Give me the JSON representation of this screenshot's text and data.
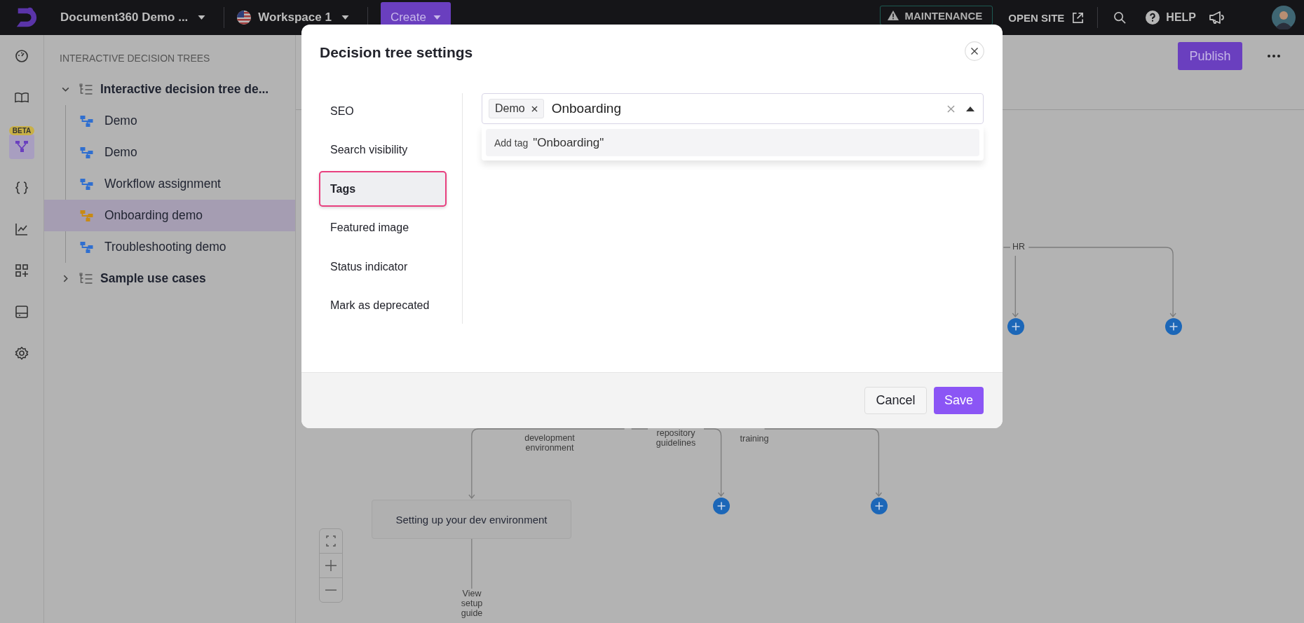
{
  "top_bar": {
    "project": "Document360 Demo ...",
    "workspace": "Workspace 1",
    "create": "Create",
    "maintenance": "MAINTENANCE",
    "open_site": "OPEN SITE",
    "help": "HELP"
  },
  "rail": [
    {
      "kind": "dashboard",
      "selected": false
    },
    {
      "kind": "book",
      "selected": false
    },
    {
      "kind": "tree",
      "selected": true,
      "badge": "BETA"
    },
    {
      "kind": "braces",
      "selected": false
    },
    {
      "kind": "chart",
      "selected": false
    },
    {
      "kind": "apps",
      "selected": false
    },
    {
      "kind": "panel",
      "selected": false
    },
    {
      "kind": "gear",
      "selected": false
    }
  ],
  "sidebar": {
    "heading": "INTERACTIVE DECISION TREES",
    "tree": [
      {
        "label": "Interactive decision tree de...",
        "expanded": true,
        "children": [
          {
            "label": "Demo",
            "selected": false,
            "color": "#2f6fd0"
          },
          {
            "label": "Demo",
            "selected": false,
            "color": "#2f6fd0"
          },
          {
            "label": "Workflow assignment",
            "selected": false,
            "color": "#2f6fd0"
          },
          {
            "label": "Onboarding demo",
            "selected": true,
            "color": "#c98a12"
          },
          {
            "label": "Troubleshooting demo",
            "selected": false,
            "color": "#2f6fd0"
          }
        ]
      },
      {
        "label": "Sample use cases",
        "expanded": false
      }
    ]
  },
  "canvas": {
    "publish": "Publish",
    "edge_labels": [
      "development environment",
      "repository guidelines",
      "training",
      "HR",
      "View setup guide"
    ],
    "node": "Setting up your dev environment"
  },
  "modal": {
    "title": "Decision tree settings",
    "nav": [
      {
        "label": "SEO",
        "selected": false
      },
      {
        "label": "Search visibility",
        "selected": false
      },
      {
        "label": "Tags",
        "selected": true
      },
      {
        "label": "Featured image",
        "selected": false
      },
      {
        "label": "Status indicator",
        "selected": false
      },
      {
        "label": "Mark as deprecated",
        "selected": false
      }
    ],
    "tag_field": {
      "tags": [
        "Demo"
      ],
      "value": "Onboarding"
    },
    "dropdown": {
      "prefix": "Add tag",
      "option": "\"Onboarding\""
    },
    "cancel": "Cancel",
    "save": "Save"
  }
}
